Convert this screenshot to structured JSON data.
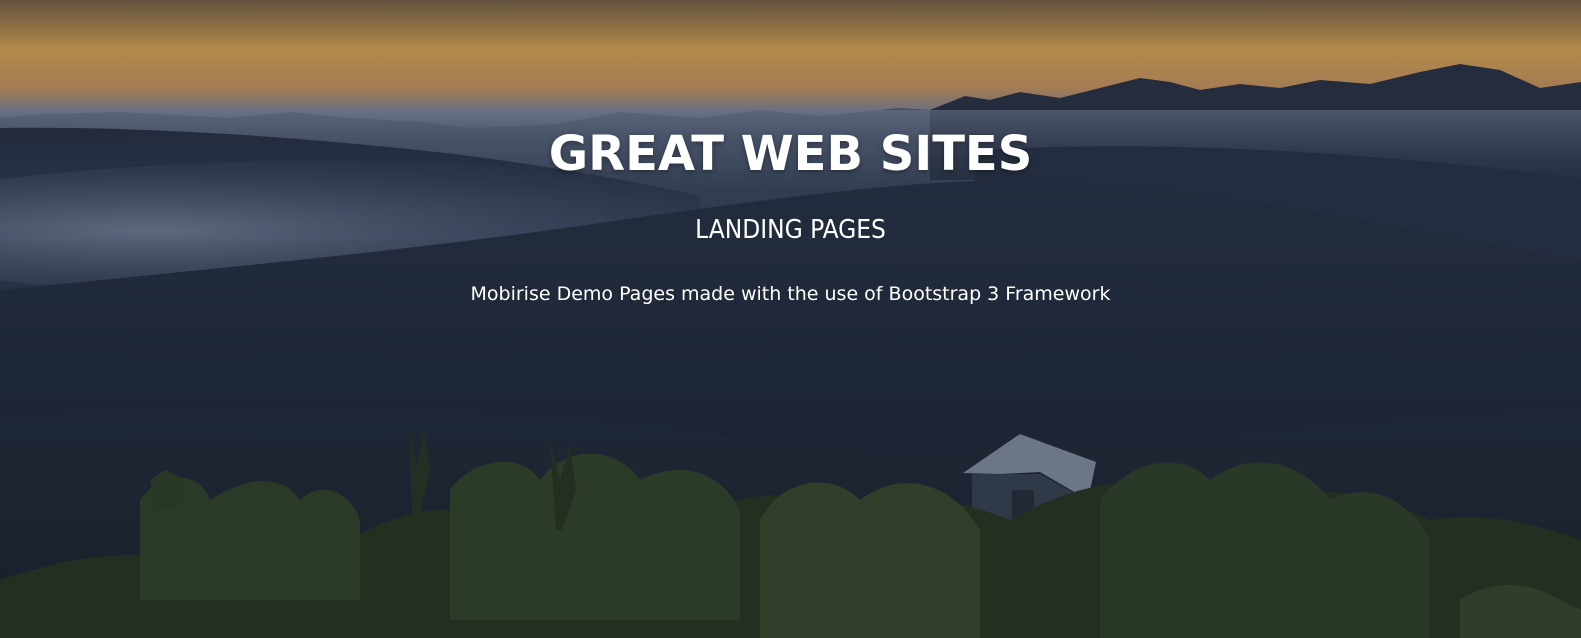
{
  "hero": {
    "title": "GREAT WEB SITES",
    "subtitle": "LANDING PAGES",
    "tagline": "Mobirise Demo Pages made with the use of Bootstrap 3 Framework"
  },
  "colors": {
    "text": "#ffffff",
    "sky_glow": "#e2a850",
    "mist": "#4d5a70",
    "foliage": "#2f3b25"
  }
}
